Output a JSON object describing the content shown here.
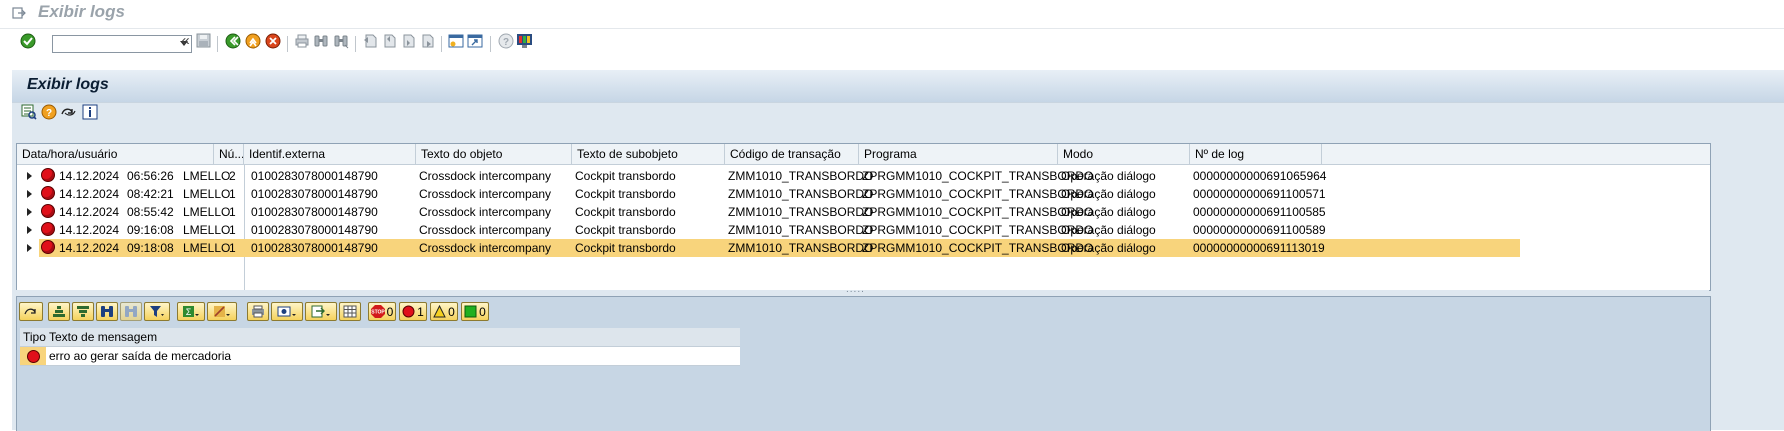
{
  "window": {
    "title": "Exibir logs"
  },
  "toolbar": {
    "command_value": "",
    "icons": [
      "enter-icon",
      "save-icon",
      "back-icon",
      "exit-icon",
      "cancel-icon",
      "print-icon",
      "find-icon",
      "find-next-icon",
      "first-page-icon",
      "previous-page-icon",
      "next-page-icon",
      "last-page-icon",
      "create-session-icon",
      "shortcut-icon",
      "help-icon",
      "customize-layout-icon"
    ]
  },
  "screen": {
    "title": "Exibir logs",
    "app_icons": [
      "detail-icon",
      "help-icon",
      "refresh-icon",
      "info-icon"
    ]
  },
  "log_table": {
    "columns": [
      "Data/hora/usuário",
      "Nú...",
      "Identif.externa",
      "Texto do objeto",
      "Texto de subobjeto",
      "Código de transação",
      "Programa",
      "Modo",
      "Nº de log"
    ],
    "rows": [
      {
        "date": "14.12.2024",
        "time": "06:56:26",
        "user": "LMELLO",
        "num": "2",
        "external_id": "0100283078000148790",
        "object": "Crossdock intercompany",
        "subobject": "Cockpit transbordo",
        "tcode": "ZMM1010_TRANSBORDO",
        "program": "ZPRGMM1010_COCKPIT_TRANSBORDO",
        "mode": "Operação diálogo",
        "log_no": "00000000000691065964",
        "selected": false
      },
      {
        "date": "14.12.2024",
        "time": "08:42:21",
        "user": "LMELLO",
        "num": "1",
        "external_id": "0100283078000148790",
        "object": "Crossdock intercompany",
        "subobject": "Cockpit transbordo",
        "tcode": "ZMM1010_TRANSBORDO",
        "program": "ZPRGMM1010_COCKPIT_TRANSBORDO",
        "mode": "Operação diálogo",
        "log_no": "00000000000691100571",
        "selected": false
      },
      {
        "date": "14.12.2024",
        "time": "08:55:42",
        "user": "LMELLO",
        "num": "1",
        "external_id": "0100283078000148790",
        "object": "Crossdock intercompany",
        "subobject": "Cockpit transbordo",
        "tcode": "ZMM1010_TRANSBORDO",
        "program": "ZPRGMM1010_COCKPIT_TRANSBORDO",
        "mode": "Operação diálogo",
        "log_no": "00000000000691100585",
        "selected": false
      },
      {
        "date": "14.12.2024",
        "time": "09:16:08",
        "user": "LMELLO",
        "num": "1",
        "external_id": "0100283078000148790",
        "object": "Crossdock intercompany",
        "subobject": "Cockpit transbordo",
        "tcode": "ZMM1010_TRANSBORDO",
        "program": "ZPRGMM1010_COCKPIT_TRANSBORDO",
        "mode": "Operação diálogo",
        "log_no": "00000000000691100589",
        "selected": false
      },
      {
        "date": "14.12.2024",
        "time": "09:18:08",
        "user": "LMELLO",
        "num": "1",
        "external_id": "0100283078000148790",
        "object": "Crossdock intercompany",
        "subobject": "Cockpit transbordo",
        "tcode": "ZMM1010_TRANSBORDO",
        "program": "ZPRGMM1010_COCKPIT_TRANSBORDO",
        "mode": "Operação diálogo",
        "log_no": "00000000000691113019",
        "selected": true
      }
    ]
  },
  "splitter": {
    "label": "....."
  },
  "messages": {
    "counters": {
      "stop": "0",
      "error": "1",
      "warning": "0",
      "success": "0"
    },
    "columns": [
      "Tipo",
      "Texto de mensagem"
    ],
    "rows": [
      {
        "type": "error",
        "text": "erro ao gerar saída de mercadoria"
      }
    ]
  },
  "colors": {
    "selection": "#f8d47c",
    "error_red": "#e0101a",
    "panel_bg": "#dfe8f0"
  }
}
